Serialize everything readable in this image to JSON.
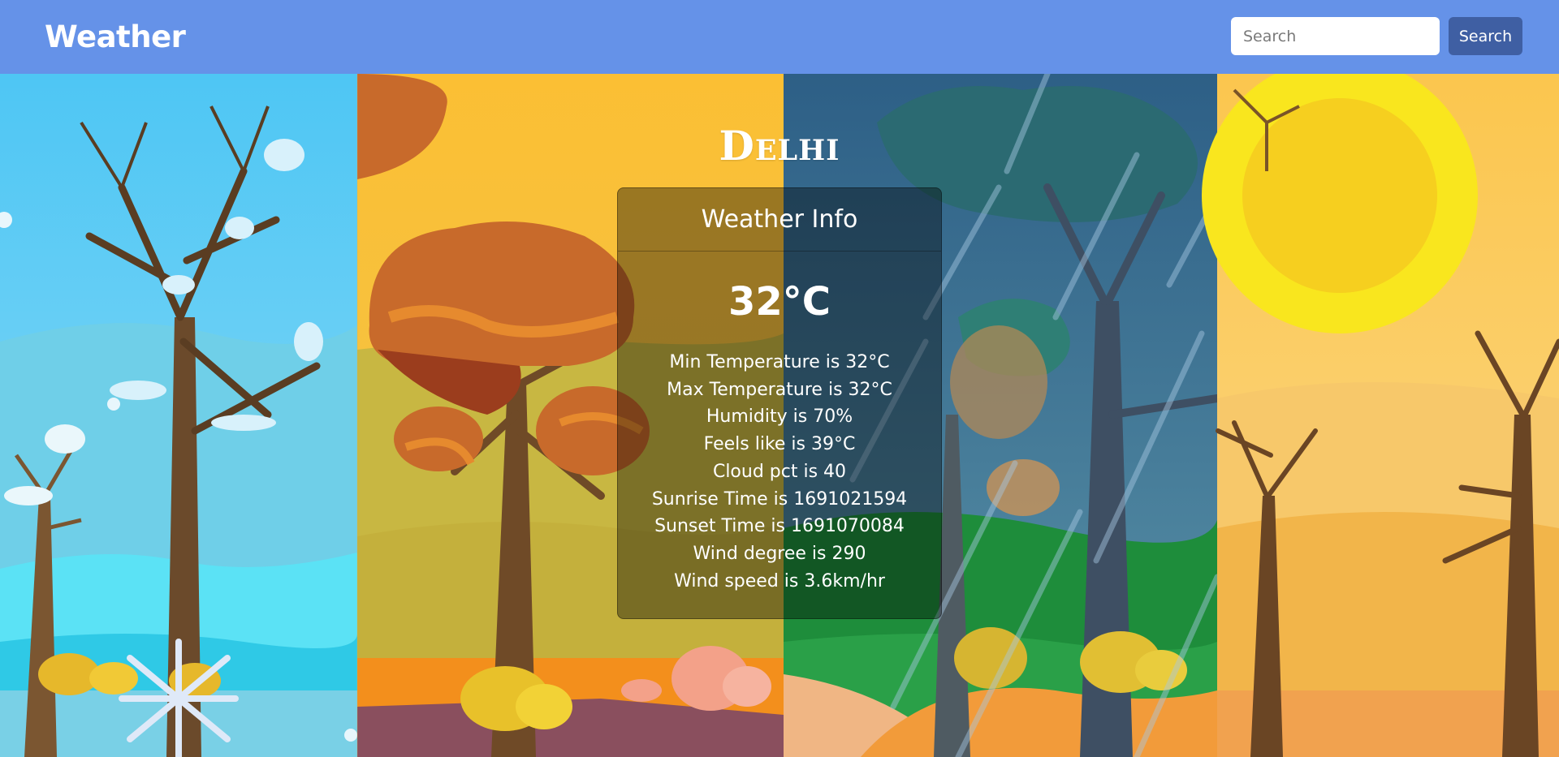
{
  "navbar": {
    "brand": "Weather",
    "search_placeholder": "Search",
    "search_button": "Search",
    "color": "#6592e8"
  },
  "city": "Delhi",
  "card": {
    "title": "Weather Info",
    "temperature": "32°C",
    "details": [
      "Min Temperature is 32°C",
      "Max Temperature is 32°C",
      "Humidity is 70%",
      "Feels like is 39°C",
      "Cloud pct is 40",
      "Sunrise Time is 1691021594",
      "Sunset Time is 1691070084",
      "Wind degree is 290",
      "Wind speed is 3.6km/hr"
    ]
  },
  "background": {
    "panels": [
      "winter",
      "autumn",
      "rainy",
      "summer"
    ]
  }
}
